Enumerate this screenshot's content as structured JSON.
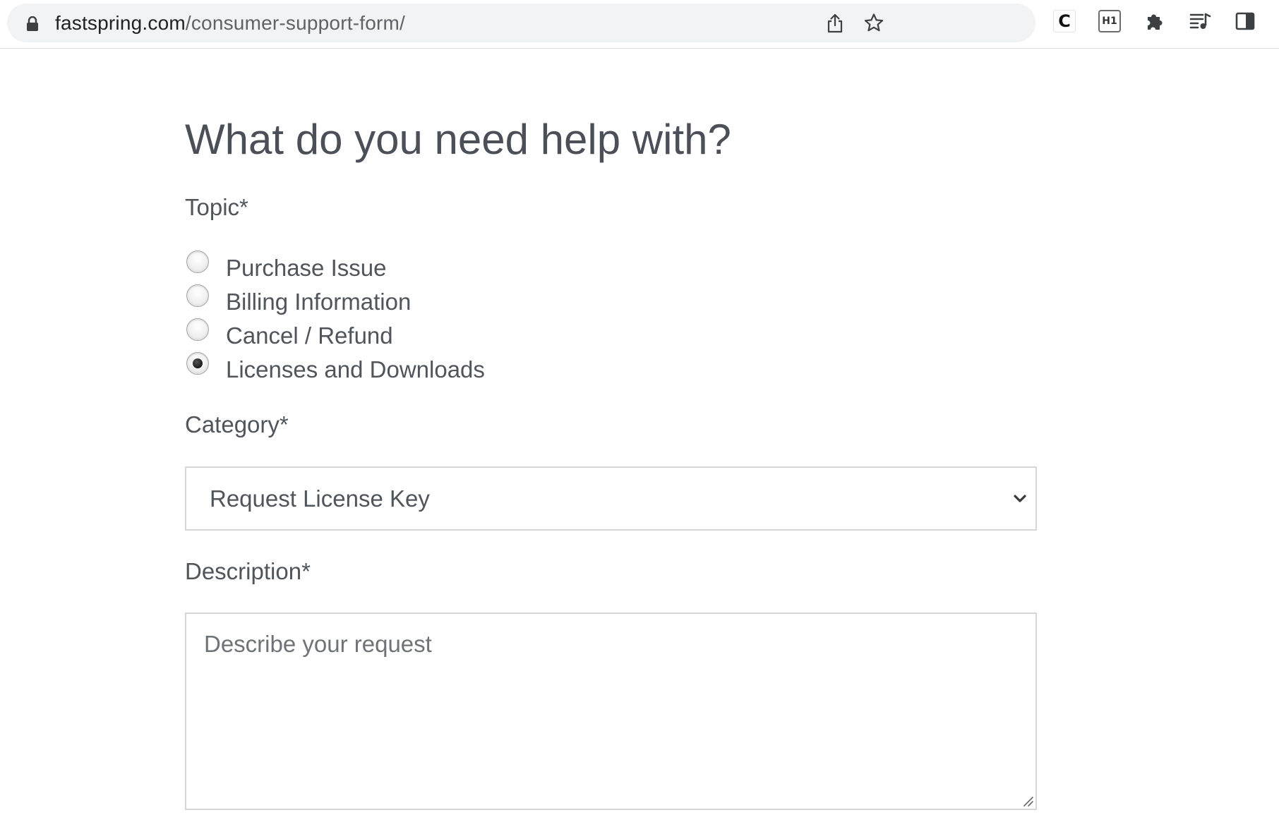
{
  "browser": {
    "url_host": "fastspring.com",
    "url_path": "/consumer-support-form/",
    "icons": [
      "lock-icon",
      "share-icon",
      "bookmark-star-icon",
      "extension-c-icon",
      "extension-h1-icon",
      "extensions-puzzle-icon",
      "reading-list-icon",
      "side-panel-icon"
    ],
    "extension_c_label": "C",
    "extension_h1_label": "H1"
  },
  "form": {
    "title": "What do you need help with?",
    "topic_label": "Topic*",
    "topics": [
      {
        "label": "Purchase Issue",
        "checked": false
      },
      {
        "label": "Billing Information",
        "checked": false
      },
      {
        "label": "Cancel / Refund",
        "checked": false
      },
      {
        "label": "Licenses and Downloads",
        "checked": true
      }
    ],
    "category_label": "Category*",
    "category_selected": "Request License Key",
    "description_label": "Description*",
    "description_placeholder": "Describe your request",
    "description_value": ""
  }
}
